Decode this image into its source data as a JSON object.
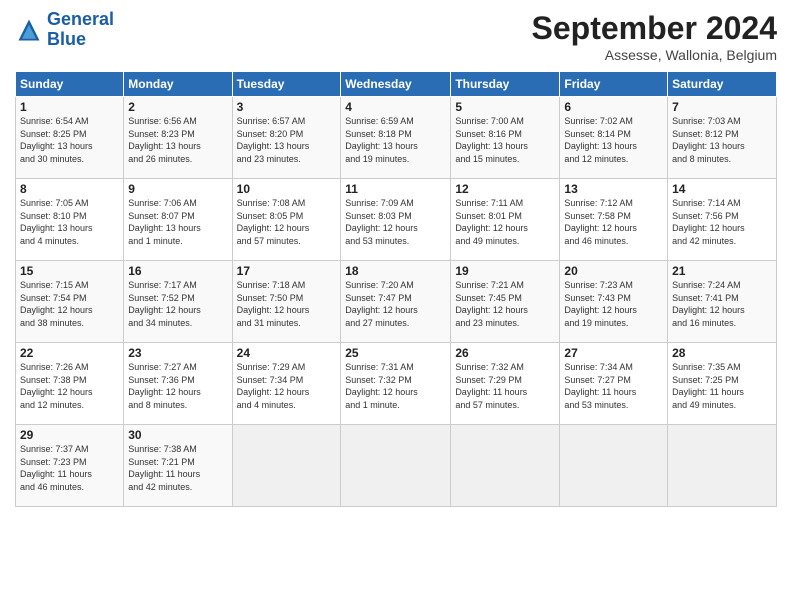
{
  "header": {
    "logo_line1": "General",
    "logo_line2": "Blue",
    "title": "September 2024",
    "subtitle": "Assesse, Wallonia, Belgium"
  },
  "calendar": {
    "days_of_week": [
      "Sunday",
      "Monday",
      "Tuesday",
      "Wednesday",
      "Thursday",
      "Friday",
      "Saturday"
    ],
    "weeks": [
      [
        {
          "day": "1",
          "info": "Sunrise: 6:54 AM\nSunset: 8:25 PM\nDaylight: 13 hours\nand 30 minutes."
        },
        {
          "day": "2",
          "info": "Sunrise: 6:56 AM\nSunset: 8:23 PM\nDaylight: 13 hours\nand 26 minutes."
        },
        {
          "day": "3",
          "info": "Sunrise: 6:57 AM\nSunset: 8:20 PM\nDaylight: 13 hours\nand 23 minutes."
        },
        {
          "day": "4",
          "info": "Sunrise: 6:59 AM\nSunset: 8:18 PM\nDaylight: 13 hours\nand 19 minutes."
        },
        {
          "day": "5",
          "info": "Sunrise: 7:00 AM\nSunset: 8:16 PM\nDaylight: 13 hours\nand 15 minutes."
        },
        {
          "day": "6",
          "info": "Sunrise: 7:02 AM\nSunset: 8:14 PM\nDaylight: 13 hours\nand 12 minutes."
        },
        {
          "day": "7",
          "info": "Sunrise: 7:03 AM\nSunset: 8:12 PM\nDaylight: 13 hours\nand 8 minutes."
        }
      ],
      [
        {
          "day": "8",
          "info": "Sunrise: 7:05 AM\nSunset: 8:10 PM\nDaylight: 13 hours\nand 4 minutes."
        },
        {
          "day": "9",
          "info": "Sunrise: 7:06 AM\nSunset: 8:07 PM\nDaylight: 13 hours\nand 1 minute."
        },
        {
          "day": "10",
          "info": "Sunrise: 7:08 AM\nSunset: 8:05 PM\nDaylight: 12 hours\nand 57 minutes."
        },
        {
          "day": "11",
          "info": "Sunrise: 7:09 AM\nSunset: 8:03 PM\nDaylight: 12 hours\nand 53 minutes."
        },
        {
          "day": "12",
          "info": "Sunrise: 7:11 AM\nSunset: 8:01 PM\nDaylight: 12 hours\nand 49 minutes."
        },
        {
          "day": "13",
          "info": "Sunrise: 7:12 AM\nSunset: 7:58 PM\nDaylight: 12 hours\nand 46 minutes."
        },
        {
          "day": "14",
          "info": "Sunrise: 7:14 AM\nSunset: 7:56 PM\nDaylight: 12 hours\nand 42 minutes."
        }
      ],
      [
        {
          "day": "15",
          "info": "Sunrise: 7:15 AM\nSunset: 7:54 PM\nDaylight: 12 hours\nand 38 minutes."
        },
        {
          "day": "16",
          "info": "Sunrise: 7:17 AM\nSunset: 7:52 PM\nDaylight: 12 hours\nand 34 minutes."
        },
        {
          "day": "17",
          "info": "Sunrise: 7:18 AM\nSunset: 7:50 PM\nDaylight: 12 hours\nand 31 minutes."
        },
        {
          "day": "18",
          "info": "Sunrise: 7:20 AM\nSunset: 7:47 PM\nDaylight: 12 hours\nand 27 minutes."
        },
        {
          "day": "19",
          "info": "Sunrise: 7:21 AM\nSunset: 7:45 PM\nDaylight: 12 hours\nand 23 minutes."
        },
        {
          "day": "20",
          "info": "Sunrise: 7:23 AM\nSunset: 7:43 PM\nDaylight: 12 hours\nand 19 minutes."
        },
        {
          "day": "21",
          "info": "Sunrise: 7:24 AM\nSunset: 7:41 PM\nDaylight: 12 hours\nand 16 minutes."
        }
      ],
      [
        {
          "day": "22",
          "info": "Sunrise: 7:26 AM\nSunset: 7:38 PM\nDaylight: 12 hours\nand 12 minutes."
        },
        {
          "day": "23",
          "info": "Sunrise: 7:27 AM\nSunset: 7:36 PM\nDaylight: 12 hours\nand 8 minutes."
        },
        {
          "day": "24",
          "info": "Sunrise: 7:29 AM\nSunset: 7:34 PM\nDaylight: 12 hours\nand 4 minutes."
        },
        {
          "day": "25",
          "info": "Sunrise: 7:31 AM\nSunset: 7:32 PM\nDaylight: 12 hours\nand 1 minute."
        },
        {
          "day": "26",
          "info": "Sunrise: 7:32 AM\nSunset: 7:29 PM\nDaylight: 11 hours\nand 57 minutes."
        },
        {
          "day": "27",
          "info": "Sunrise: 7:34 AM\nSunset: 7:27 PM\nDaylight: 11 hours\nand 53 minutes."
        },
        {
          "day": "28",
          "info": "Sunrise: 7:35 AM\nSunset: 7:25 PM\nDaylight: 11 hours\nand 49 minutes."
        }
      ],
      [
        {
          "day": "29",
          "info": "Sunrise: 7:37 AM\nSunset: 7:23 PM\nDaylight: 11 hours\nand 46 minutes."
        },
        {
          "day": "30",
          "info": "Sunrise: 7:38 AM\nSunset: 7:21 PM\nDaylight: 11 hours\nand 42 minutes."
        },
        {
          "day": "",
          "info": ""
        },
        {
          "day": "",
          "info": ""
        },
        {
          "day": "",
          "info": ""
        },
        {
          "day": "",
          "info": ""
        },
        {
          "day": "",
          "info": ""
        }
      ]
    ]
  }
}
